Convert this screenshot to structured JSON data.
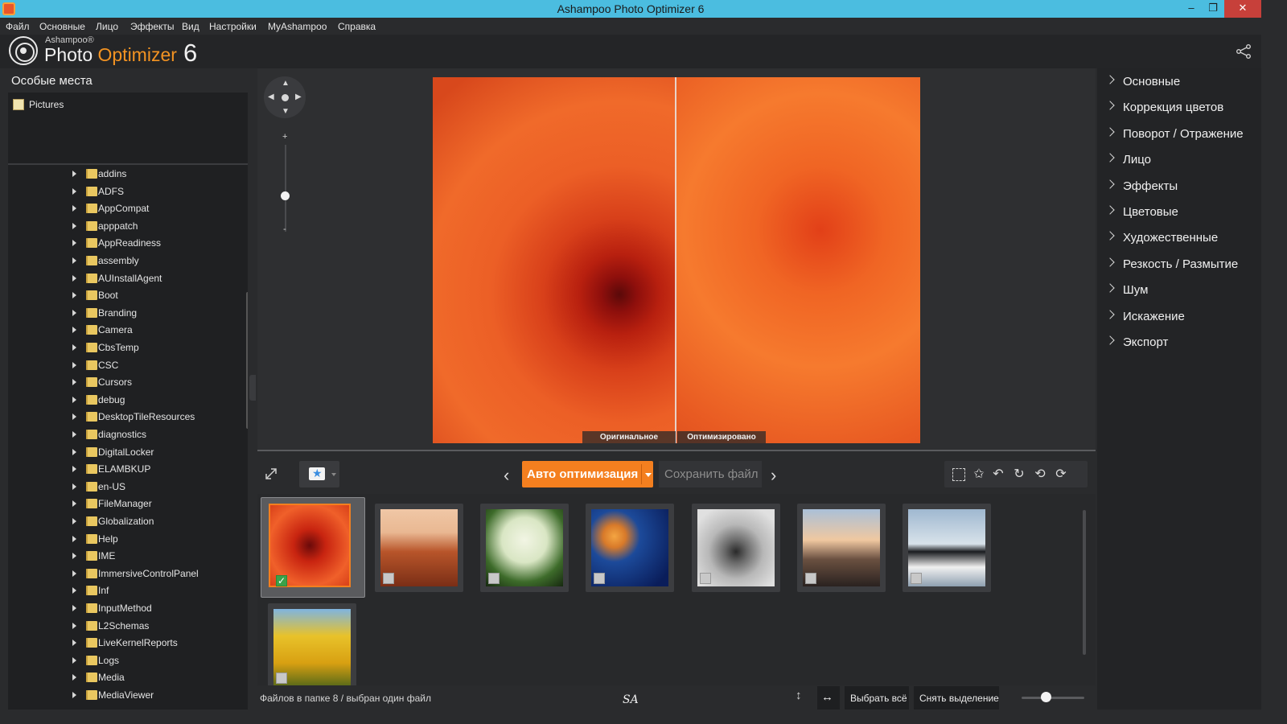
{
  "window": {
    "title": "Ashampoo Photo Optimizer 6",
    "minimize_glyph": "–",
    "maximize_glyph": "❐",
    "close_glyph": "✕"
  },
  "menu": [
    "Файл",
    "Основные",
    "Лицо",
    "Эффекты",
    "Вид",
    "Настройки",
    "MyAshampoo",
    "Справка"
  ],
  "logo": {
    "brand": "Ashampoo®",
    "product_a": "Photo ",
    "product_b": "Optimizer",
    "version": "6"
  },
  "left_panel": {
    "title": "Особые места",
    "favorites": [
      "Pictures"
    ],
    "folders": [
      "addins",
      "ADFS",
      "AppCompat",
      "apppatch",
      "AppReadiness",
      "assembly",
      "AUInstallAgent",
      "Boot",
      "Branding",
      "Camera",
      "CbsTemp",
      "CSC",
      "Cursors",
      "debug",
      "DesktopTileResources",
      "diagnostics",
      "DigitalLocker",
      "ELAMBKUP",
      "en-US",
      "FileManager",
      "Globalization",
      "Help",
      "IME",
      "ImmersiveControlPanel",
      "Inf",
      "InputMethod",
      "L2Schemas",
      "LiveKernelReports",
      "Logs",
      "Media",
      "MediaViewer"
    ]
  },
  "preview": {
    "label_original": "Оригинальное",
    "label_optimized": "Оптимизировано",
    "zoom_plus": "+",
    "zoom_minus": "-"
  },
  "right_panel": {
    "items": [
      "Основные",
      "Коррекция цветов",
      "Поворот / Отражение",
      "Лицо",
      "Эффекты",
      "Цветовые",
      "Художественные",
      "Резкость / Размытие",
      "Шум",
      "Искажение",
      "Экспорт"
    ]
  },
  "toolbar": {
    "auto_optimize": "Авто оптимизация",
    "save_file": "Сохранить файл",
    "prev_glyph": "‹",
    "next_glyph": "›"
  },
  "thumbnails": {
    "count": 8,
    "selected_index": 0,
    "items": [
      {
        "subject": "flower-orange",
        "checked": true
      },
      {
        "subject": "desert-rock",
        "checked": false
      },
      {
        "subject": "hydrangea",
        "checked": false
      },
      {
        "subject": "jellyfish",
        "checked": false
      },
      {
        "subject": "koala",
        "checked": false
      },
      {
        "subject": "lighthouse",
        "checked": false
      },
      {
        "subject": "penguins",
        "checked": false
      },
      {
        "subject": "tulips",
        "checked": false
      }
    ]
  },
  "status": {
    "text": "Файлов в папке 8 / выбран один файл",
    "watermark": "SA",
    "select_all": "Выбрать всё",
    "deselect": "Снять выделение"
  },
  "colors": {
    "accent": "#f47f1f",
    "titlebar": "#4bbde0",
    "close": "#c7403a"
  }
}
